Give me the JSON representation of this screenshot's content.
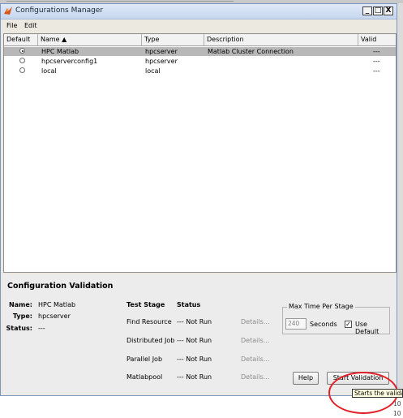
{
  "window": {
    "title": "Configurations Manager",
    "controls": {
      "minimize": "_",
      "maximize": "□",
      "close": "X"
    }
  },
  "menu": [
    "File",
    "Edit"
  ],
  "table": {
    "columns": [
      "Default",
      "Name ▲",
      "Type",
      "Description",
      "Valid"
    ],
    "rows": [
      {
        "name": "HPC Matlab",
        "type": "hpcserver",
        "description": "Matlab Cluster Connection",
        "valid": "---",
        "default": true,
        "selected": true
      },
      {
        "name": "hpcserverconfig1",
        "type": "hpcserver",
        "description": "",
        "valid": "---",
        "default": false,
        "selected": false
      },
      {
        "name": "local",
        "type": "local",
        "description": "",
        "valid": "---",
        "default": false,
        "selected": false
      }
    ]
  },
  "validation": {
    "title": "Configuration Validation",
    "name_label": "Name:",
    "name_value": "HPC Matlab",
    "type_label": "Type:",
    "type_value": "hpcserver",
    "status_label": "Status:",
    "status_value": "---",
    "test_stage_header": "Test Stage",
    "status_header": "Status",
    "stages": [
      {
        "name": "Find Resource",
        "status": "--- Not Run",
        "details": "Details..."
      },
      {
        "name": "Distributed Job",
        "status": "--- Not Run",
        "details": "Details..."
      },
      {
        "name": "Parallel Job",
        "status": "--- Not Run",
        "details": "Details..."
      },
      {
        "name": "Matlabpool",
        "status": "--- Not Run",
        "details": "Details..."
      }
    ],
    "max_time": {
      "legend": "Max Time Per Stage",
      "value": "240",
      "unit": "Seconds",
      "use_default_label": "Use Default",
      "use_default_checked": true
    },
    "help_button": "Help",
    "start_button": "Start Validation"
  },
  "tooltip": "Starts the validat",
  "background_fragments": [
    "10",
    "10"
  ],
  "colors": {
    "selection": "#b8b8b8",
    "annotation": "#e2222b",
    "tooltip_bg": "#ffffe1"
  }
}
